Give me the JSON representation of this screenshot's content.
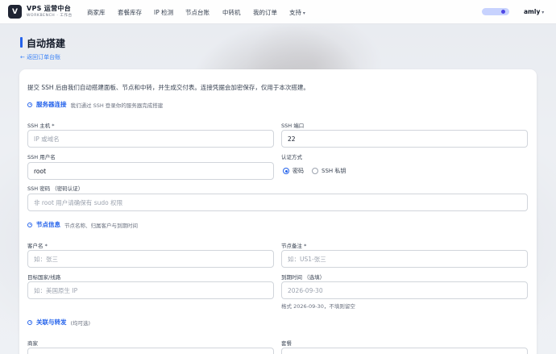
{
  "nav": {
    "logo": "V",
    "brand_title": "VPS 运营中台",
    "brand_sub": "WORKBENCH · 工作台",
    "items": [
      "商家库",
      "套餐库存",
      "IP 检测",
      "节点台账",
      "中转机",
      "我的订单",
      "支持"
    ],
    "user": "amly"
  },
  "header": {
    "title": "自动搭建",
    "back": "← 返回订单台账"
  },
  "form": {
    "intro": "提交 SSH 后由我们自动搭建面板、节点和中转，并生成交付表。连接凭据会加密保存，仅用于本次搭建。",
    "sections": {
      "server": {
        "title": "服务器连接",
        "desc": "我们通过 SSH 登录你的服务器完成搭建"
      },
      "node": {
        "title": "节点信息",
        "desc": "节点名称、归属客户与到期时间"
      },
      "relay": {
        "title": "关联与转发",
        "desc": "(均可选)"
      }
    },
    "ssh_host": {
      "label": "SSH 主机 *",
      "value": "",
      "placeholder": "IP 或域名"
    },
    "ssh_port": {
      "label": "SSH 端口",
      "value": "22",
      "placeholder": ""
    },
    "ssh_user": {
      "label": "SSH 用户名",
      "value": "root",
      "placeholder": ""
    },
    "auth": {
      "label": "认证方式",
      "options": [
        "密码",
        "SSH 私钥"
      ],
      "selected": 0
    },
    "ssh_password": {
      "label": "SSH 密码 （密码认证）",
      "value": "",
      "placeholder": "非 root 用户请确保有 sudo 权限"
    },
    "customer": {
      "label": "客户名 *",
      "value": "",
      "placeholder": "如：张三"
    },
    "node_note": {
      "label": "节点备注 *",
      "value": "",
      "placeholder": "如：US1-张三"
    },
    "region": {
      "label": "目标国家/线路",
      "value": "",
      "placeholder": "如：美国原生 IP"
    },
    "expire": {
      "label": "到期时间 （选填）",
      "value": "",
      "placeholder": "2026-09-30",
      "hint": "格式 2026-09-30，不填则留空"
    },
    "merchant": {
      "label": "商家"
    },
    "plan": {
      "label": "套餐"
    }
  },
  "colors": {
    "accent": "#2563eb",
    "nav_dark": "#1f2433"
  }
}
